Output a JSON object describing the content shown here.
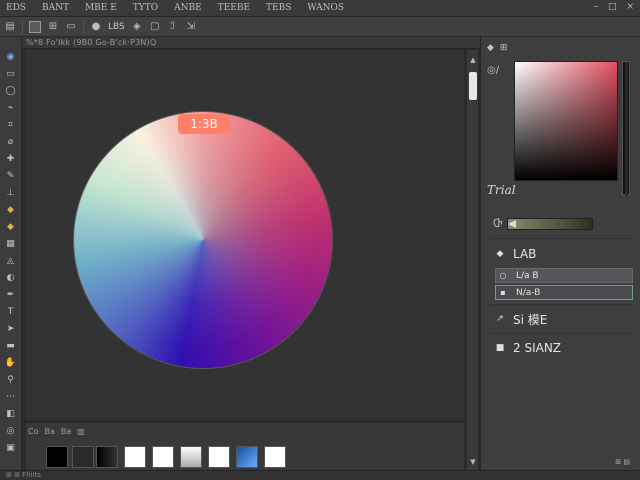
{
  "menubar": {
    "items": [
      "EDS",
      "BANT",
      "MBE E",
      "TYTO",
      "ANBE",
      "TEEBE",
      "TEBS",
      "WANOS"
    ],
    "window_controls": [
      "–",
      "□",
      "×"
    ]
  },
  "optbar": {
    "label": "LBS",
    "icons": [
      "new-icon",
      "box-icon",
      "grid-icon",
      "circle-icon",
      "shape-icon",
      "move-icon",
      "frame-icon"
    ]
  },
  "tabstrip": {
    "text": "%*8 Fo'Ikk (9B0 Go-B'ck·P3N)Q"
  },
  "canvas": {
    "badge": "1:3B"
  },
  "swatch_panel": {
    "header": [
      "Co",
      "Ba",
      "Ba"
    ],
    "colors": [
      "#000000",
      "#2a2a2a",
      "#1a1a1a",
      "#ffffff",
      "#ffffff",
      "#d8d8d8",
      "#ffffff",
      "#2a60c0",
      "#ffffff"
    ]
  },
  "statusbar": {
    "text": "⊞ ⊞ Fhlits"
  },
  "color_panel": {
    "header_icons": [
      "diamond-icon",
      "swatch-icon"
    ],
    "picker_label": "Trial",
    "modes": {
      "lab": "LAB",
      "field1": "L/a B",
      "field2": "N/a-B",
      "mode3": "Si 模E",
      "mode4": "2 SIANZ"
    },
    "accent": "#e05060"
  }
}
